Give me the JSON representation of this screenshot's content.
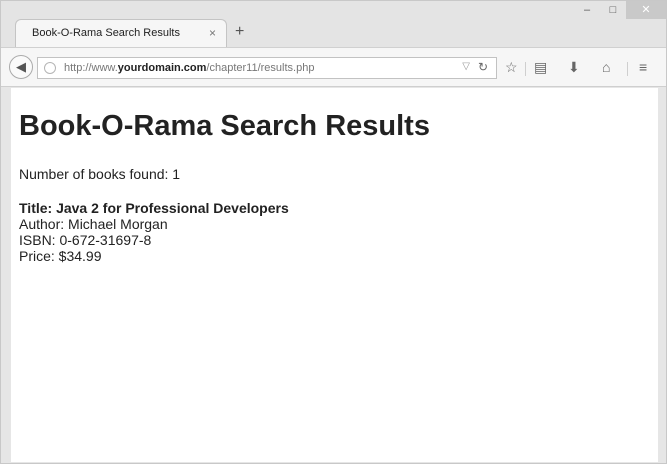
{
  "tab": {
    "title": "Book-O-Rama Search Results",
    "close": "×",
    "new_tab": "+"
  },
  "window_controls": {
    "minimize": "–",
    "maximize": "□",
    "close": "✕"
  },
  "navbar": {
    "url_prefix": "http://www.",
    "url_domain": "yourdomain.com",
    "url_path": "/chapter11/results.php",
    "icons": [
      "back-icon",
      "globe-icon",
      "dropdown-icon",
      "reload-icon",
      "bookmark-star-icon",
      "reading-list-icon",
      "download-icon",
      "home-icon",
      "menu-icon"
    ]
  },
  "page": {
    "heading": "Book-O-Rama Search Results",
    "count_text": "Number of books found: 1",
    "book": {
      "title": "Title: Java 2 for Professional Developers",
      "author": "Author: Michael Morgan",
      "isbn": "ISBN: 0-672-31697-8",
      "price": "Price: $34.99"
    }
  }
}
